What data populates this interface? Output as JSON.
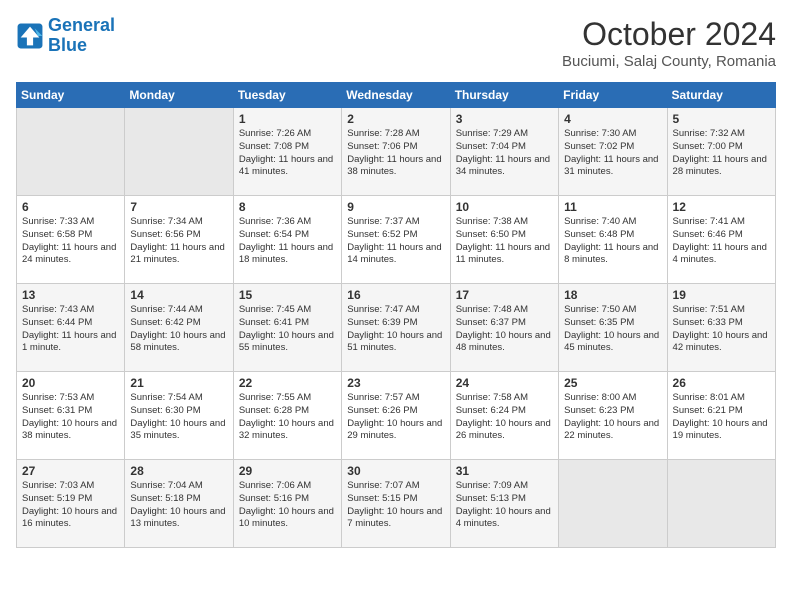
{
  "header": {
    "logo_line1": "General",
    "logo_line2": "Blue",
    "title": "October 2024",
    "subtitle": "Buciumi, Salaj County, Romania"
  },
  "weekdays": [
    "Sunday",
    "Monday",
    "Tuesday",
    "Wednesday",
    "Thursday",
    "Friday",
    "Saturday"
  ],
  "weeks": [
    [
      {
        "day": "",
        "info": ""
      },
      {
        "day": "",
        "info": ""
      },
      {
        "day": "1",
        "info": "Sunrise: 7:26 AM\nSunset: 7:08 PM\nDaylight: 11 hours and 41 minutes."
      },
      {
        "day": "2",
        "info": "Sunrise: 7:28 AM\nSunset: 7:06 PM\nDaylight: 11 hours and 38 minutes."
      },
      {
        "day": "3",
        "info": "Sunrise: 7:29 AM\nSunset: 7:04 PM\nDaylight: 11 hours and 34 minutes."
      },
      {
        "day": "4",
        "info": "Sunrise: 7:30 AM\nSunset: 7:02 PM\nDaylight: 11 hours and 31 minutes."
      },
      {
        "day": "5",
        "info": "Sunrise: 7:32 AM\nSunset: 7:00 PM\nDaylight: 11 hours and 28 minutes."
      }
    ],
    [
      {
        "day": "6",
        "info": "Sunrise: 7:33 AM\nSunset: 6:58 PM\nDaylight: 11 hours and 24 minutes."
      },
      {
        "day": "7",
        "info": "Sunrise: 7:34 AM\nSunset: 6:56 PM\nDaylight: 11 hours and 21 minutes."
      },
      {
        "day": "8",
        "info": "Sunrise: 7:36 AM\nSunset: 6:54 PM\nDaylight: 11 hours and 18 minutes."
      },
      {
        "day": "9",
        "info": "Sunrise: 7:37 AM\nSunset: 6:52 PM\nDaylight: 11 hours and 14 minutes."
      },
      {
        "day": "10",
        "info": "Sunrise: 7:38 AM\nSunset: 6:50 PM\nDaylight: 11 hours and 11 minutes."
      },
      {
        "day": "11",
        "info": "Sunrise: 7:40 AM\nSunset: 6:48 PM\nDaylight: 11 hours and 8 minutes."
      },
      {
        "day": "12",
        "info": "Sunrise: 7:41 AM\nSunset: 6:46 PM\nDaylight: 11 hours and 4 minutes."
      }
    ],
    [
      {
        "day": "13",
        "info": "Sunrise: 7:43 AM\nSunset: 6:44 PM\nDaylight: 11 hours and 1 minute."
      },
      {
        "day": "14",
        "info": "Sunrise: 7:44 AM\nSunset: 6:42 PM\nDaylight: 10 hours and 58 minutes."
      },
      {
        "day": "15",
        "info": "Sunrise: 7:45 AM\nSunset: 6:41 PM\nDaylight: 10 hours and 55 minutes."
      },
      {
        "day": "16",
        "info": "Sunrise: 7:47 AM\nSunset: 6:39 PM\nDaylight: 10 hours and 51 minutes."
      },
      {
        "day": "17",
        "info": "Sunrise: 7:48 AM\nSunset: 6:37 PM\nDaylight: 10 hours and 48 minutes."
      },
      {
        "day": "18",
        "info": "Sunrise: 7:50 AM\nSunset: 6:35 PM\nDaylight: 10 hours and 45 minutes."
      },
      {
        "day": "19",
        "info": "Sunrise: 7:51 AM\nSunset: 6:33 PM\nDaylight: 10 hours and 42 minutes."
      }
    ],
    [
      {
        "day": "20",
        "info": "Sunrise: 7:53 AM\nSunset: 6:31 PM\nDaylight: 10 hours and 38 minutes."
      },
      {
        "day": "21",
        "info": "Sunrise: 7:54 AM\nSunset: 6:30 PM\nDaylight: 10 hours and 35 minutes."
      },
      {
        "day": "22",
        "info": "Sunrise: 7:55 AM\nSunset: 6:28 PM\nDaylight: 10 hours and 32 minutes."
      },
      {
        "day": "23",
        "info": "Sunrise: 7:57 AM\nSunset: 6:26 PM\nDaylight: 10 hours and 29 minutes."
      },
      {
        "day": "24",
        "info": "Sunrise: 7:58 AM\nSunset: 6:24 PM\nDaylight: 10 hours and 26 minutes."
      },
      {
        "day": "25",
        "info": "Sunrise: 8:00 AM\nSunset: 6:23 PM\nDaylight: 10 hours and 22 minutes."
      },
      {
        "day": "26",
        "info": "Sunrise: 8:01 AM\nSunset: 6:21 PM\nDaylight: 10 hours and 19 minutes."
      }
    ],
    [
      {
        "day": "27",
        "info": "Sunrise: 7:03 AM\nSunset: 5:19 PM\nDaylight: 10 hours and 16 minutes."
      },
      {
        "day": "28",
        "info": "Sunrise: 7:04 AM\nSunset: 5:18 PM\nDaylight: 10 hours and 13 minutes."
      },
      {
        "day": "29",
        "info": "Sunrise: 7:06 AM\nSunset: 5:16 PM\nDaylight: 10 hours and 10 minutes."
      },
      {
        "day": "30",
        "info": "Sunrise: 7:07 AM\nSunset: 5:15 PM\nDaylight: 10 hours and 7 minutes."
      },
      {
        "day": "31",
        "info": "Sunrise: 7:09 AM\nSunset: 5:13 PM\nDaylight: 10 hours and 4 minutes."
      },
      {
        "day": "",
        "info": ""
      },
      {
        "day": "",
        "info": ""
      }
    ]
  ]
}
